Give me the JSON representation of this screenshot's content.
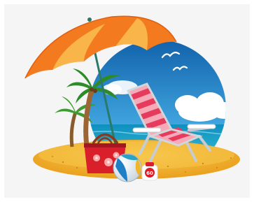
{
  "image": {
    "description_tags": [
      "umbrella-icon",
      "palm-tree-icon",
      "beach-chair-icon",
      "beach-bag-icon",
      "beach-ball-icon",
      "sunscreen-icon",
      "seagull-icon",
      "cloud-icon",
      "sand-island-icon"
    ],
    "sunscreen_label": "60",
    "colors": {
      "sky": "#2f86c9",
      "sea": "#1aa4c8",
      "sand": "#f2b531",
      "umbrella_orange": "#f47a1f",
      "umbrella_light": "#f9b54a",
      "chair_stripe": "#e73b5e",
      "bag": "#d81f2a"
    }
  }
}
